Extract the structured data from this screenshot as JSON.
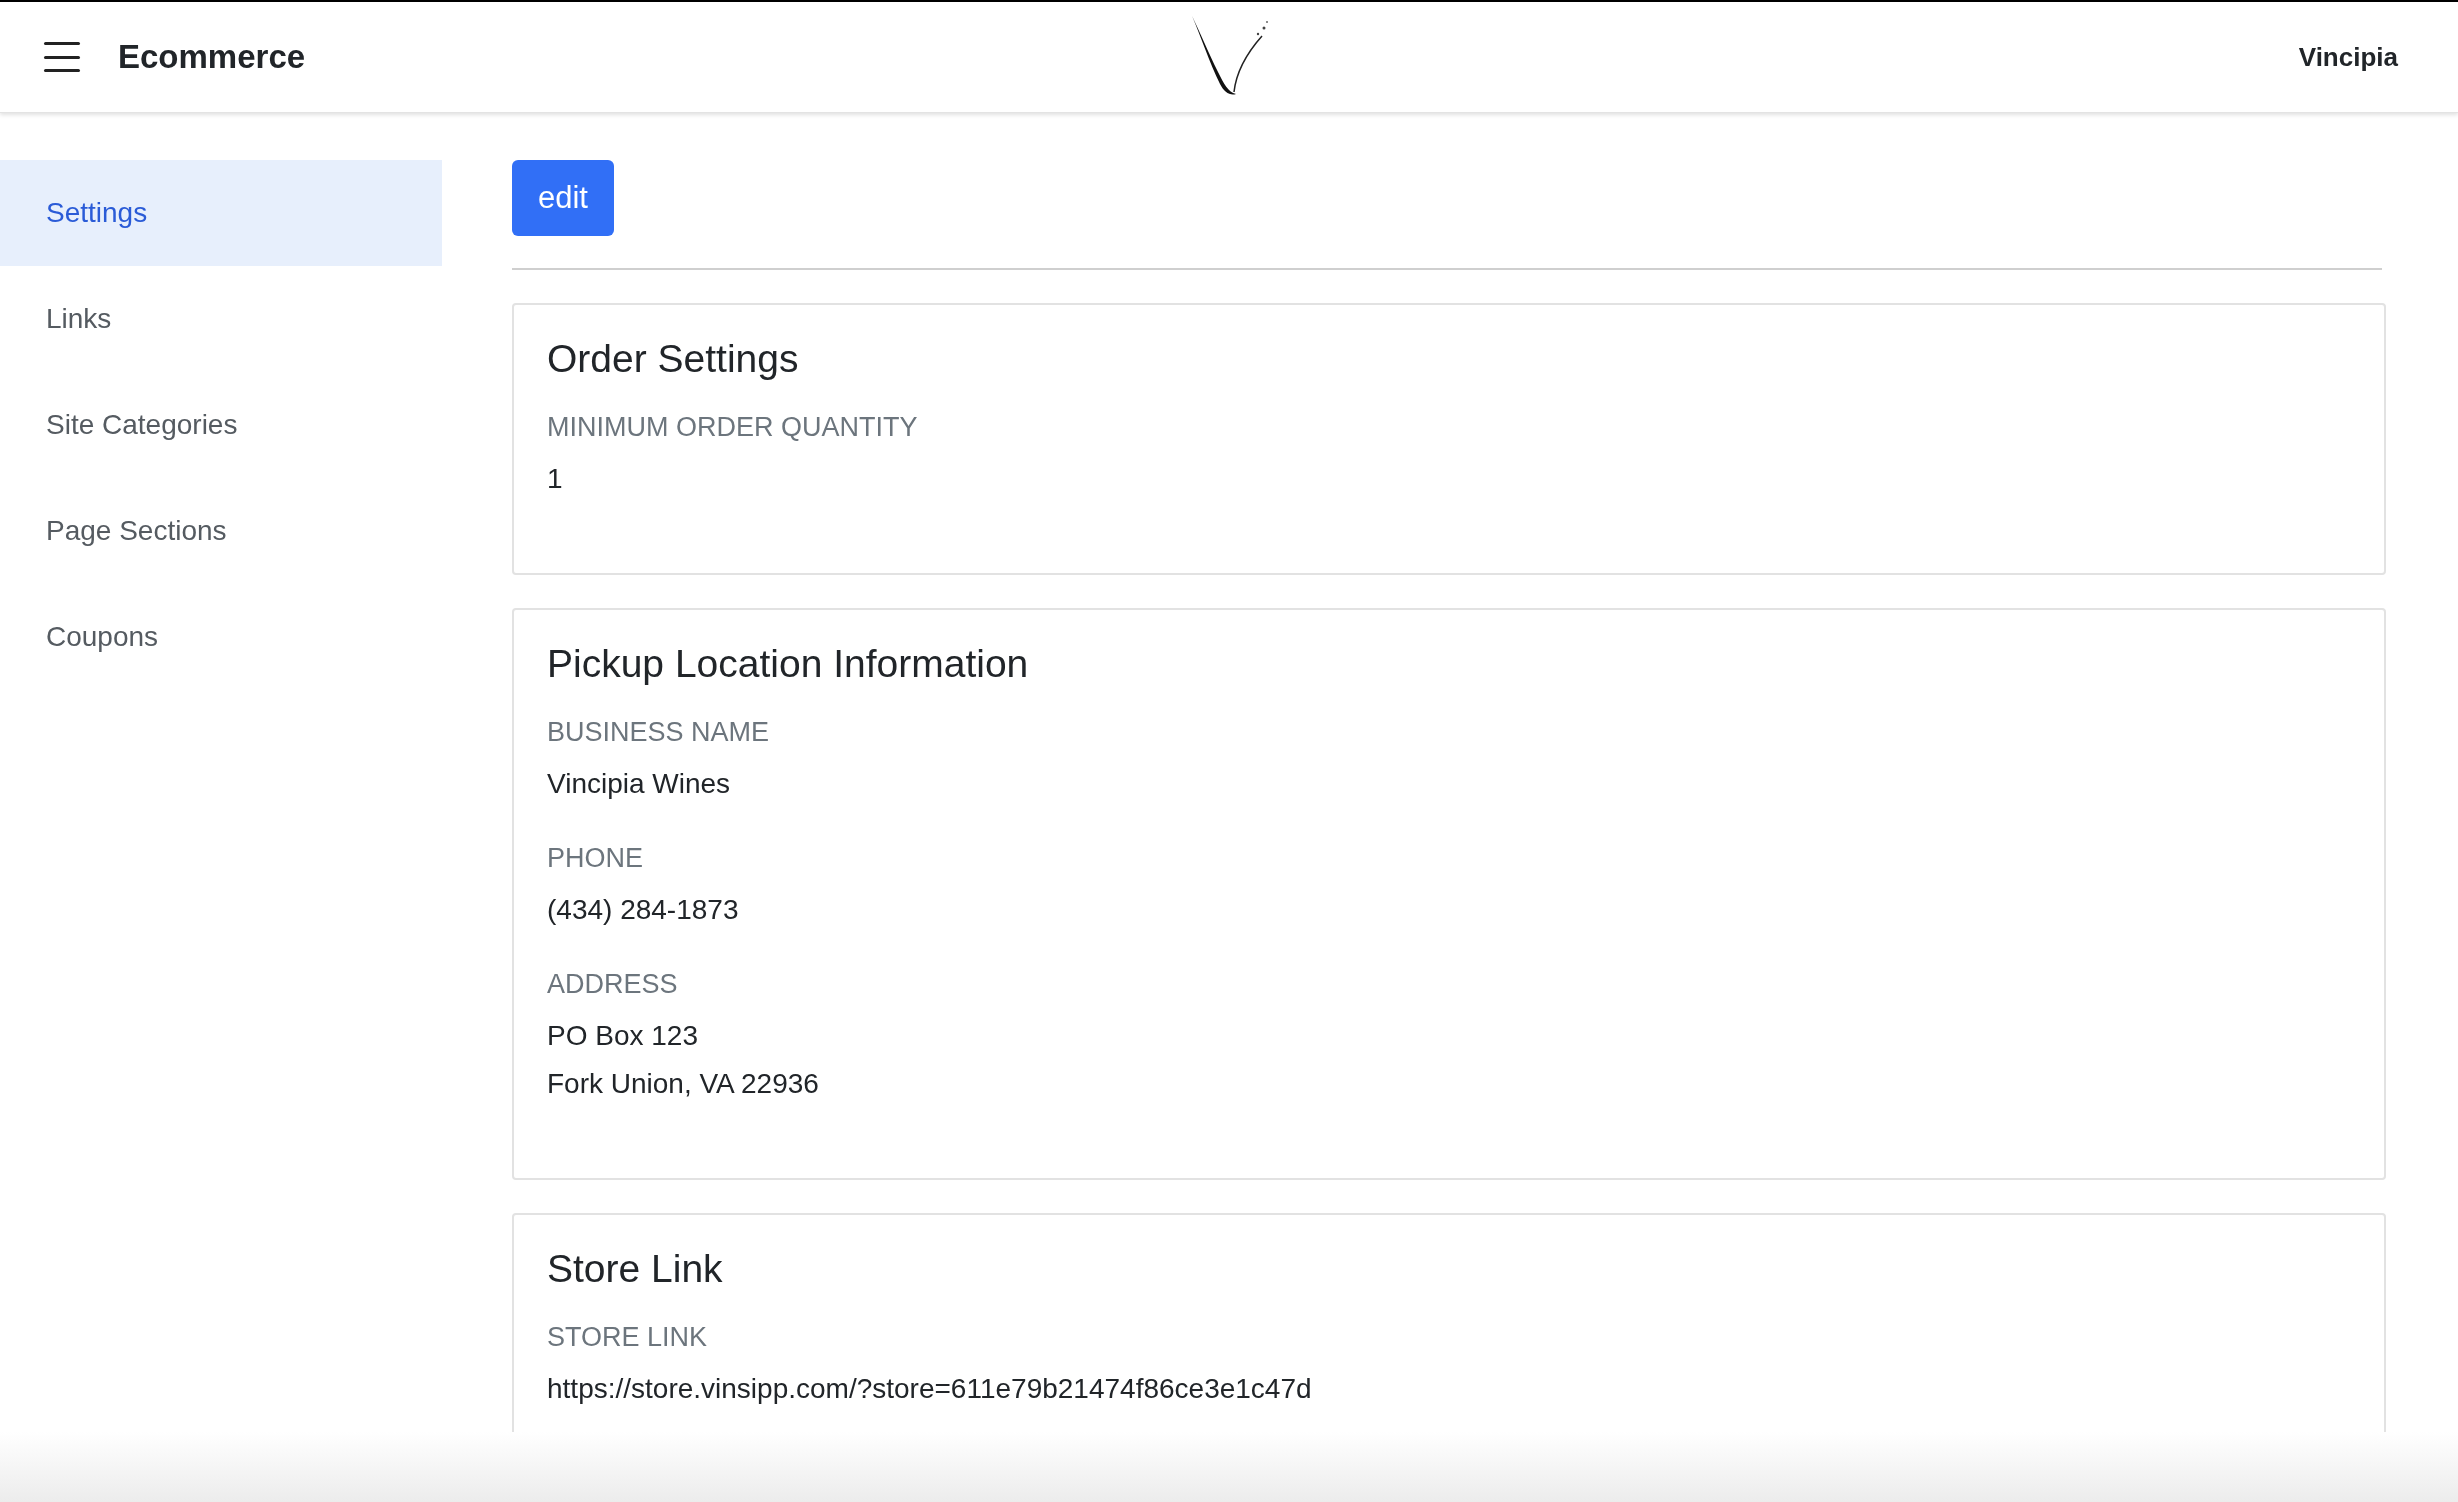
{
  "header": {
    "title": "Ecommerce",
    "user": "Vincipia"
  },
  "sidebar": {
    "items": [
      {
        "label": "Settings",
        "selected": true
      },
      {
        "label": "Links",
        "selected": false
      },
      {
        "label": "Site Categories",
        "selected": false
      },
      {
        "label": "Page Sections",
        "selected": false
      },
      {
        "label": "Coupons",
        "selected": false
      }
    ]
  },
  "edit_button": "edit",
  "cards": [
    {
      "title": "Order Settings",
      "fields": [
        {
          "label": "MINIMUM ORDER QUANTITY",
          "lines": [
            "1"
          ]
        }
      ]
    },
    {
      "title": "Pickup Location Information",
      "fields": [
        {
          "label": "BUSINESS NAME",
          "lines": [
            "Vincipia Wines"
          ]
        },
        {
          "label": "PHONE",
          "lines": [
            "(434) 284-1873"
          ]
        },
        {
          "label": "ADDRESS",
          "lines": [
            "PO Box 123",
            "Fork Union, VA 22936"
          ]
        }
      ]
    },
    {
      "title": "Store Link",
      "fields": [
        {
          "label": "STORE LINK",
          "lines": [
            "https://store.vinsipp.com/?store=611e79b21474f86ce3e1c47d"
          ]
        }
      ]
    }
  ]
}
